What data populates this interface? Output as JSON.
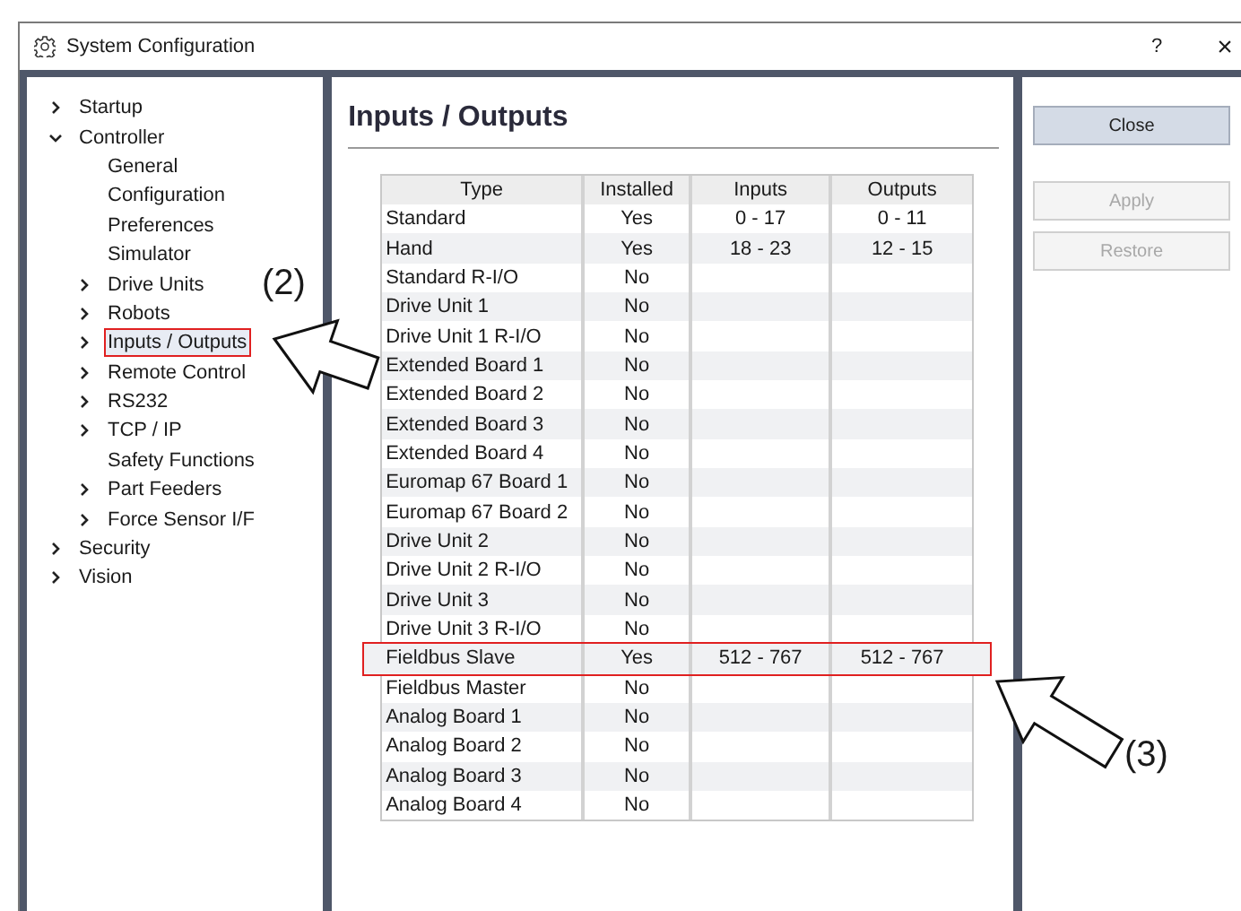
{
  "window": {
    "title": "System Configuration",
    "help": "?",
    "close": "×"
  },
  "tree": [
    {
      "label": "Startup",
      "kind": "node",
      "expanded": false,
      "selected": false
    },
    {
      "label": "Controller",
      "kind": "node",
      "expanded": true,
      "selected": false,
      "children": [
        {
          "label": "General",
          "kind": "leaf",
          "selected": false
        },
        {
          "label": "Configuration",
          "kind": "leaf",
          "selected": false
        },
        {
          "label": "Preferences",
          "kind": "leaf",
          "selected": false
        },
        {
          "label": "Simulator",
          "kind": "leaf",
          "selected": false
        },
        {
          "label": "Drive Units",
          "kind": "node",
          "expanded": false,
          "selected": false
        },
        {
          "label": "Robots",
          "kind": "node",
          "expanded": false,
          "selected": false
        },
        {
          "label": "Inputs / Outputs",
          "kind": "node",
          "expanded": false,
          "selected": true,
          "annotated": true
        },
        {
          "label": "Remote Control",
          "kind": "node",
          "expanded": false,
          "selected": false
        },
        {
          "label": "RS232",
          "kind": "node",
          "expanded": false,
          "selected": false
        },
        {
          "label": "TCP / IP",
          "kind": "node",
          "expanded": false,
          "selected": false
        },
        {
          "label": "Safety Functions",
          "kind": "leaf",
          "selected": false
        },
        {
          "label": "Part Feeders",
          "kind": "node",
          "expanded": false,
          "selected": false
        },
        {
          "label": "Force Sensor I/F",
          "kind": "node",
          "expanded": false,
          "selected": false
        }
      ]
    },
    {
      "label": "Security",
      "kind": "node",
      "expanded": false,
      "selected": false
    },
    {
      "label": "Vision",
      "kind": "node",
      "expanded": false,
      "selected": false
    }
  ],
  "page_title": "Inputs / Outputs",
  "table": {
    "columns": [
      "Type",
      "Installed",
      "Inputs",
      "Outputs"
    ],
    "rows": [
      {
        "type": "Standard",
        "installed": "Yes",
        "inputs": "0 - 17",
        "outputs": "0 - 11"
      },
      {
        "type": "Hand",
        "installed": "Yes",
        "inputs": "18 - 23",
        "outputs": "12 - 15"
      },
      {
        "type": "Standard R-I/O",
        "installed": "No"
      },
      {
        "type": "Drive Unit 1",
        "installed": "No"
      },
      {
        "type": "Drive Unit 1 R-I/O",
        "installed": "No"
      },
      {
        "type": "Extended Board 1",
        "installed": "No"
      },
      {
        "type": "Extended Board 2",
        "installed": "No"
      },
      {
        "type": "Extended Board 3",
        "installed": "No"
      },
      {
        "type": "Extended Board 4",
        "installed": "No"
      },
      {
        "type": "Euromap 67 Board 1",
        "installed": "No"
      },
      {
        "type": "Euromap 67 Board 2",
        "installed": "No"
      },
      {
        "type": "Drive Unit 2",
        "installed": "No"
      },
      {
        "type": "Drive Unit 2 R-I/O",
        "installed": "No"
      },
      {
        "type": "Drive Unit 3",
        "installed": "No"
      },
      {
        "type": "Drive Unit 3 R-I/O",
        "installed": "No"
      },
      {
        "type": "Fieldbus Slave",
        "installed": "Yes",
        "inputs": "512 - 767",
        "outputs": "512 - 767",
        "annotated": true
      },
      {
        "type": "Fieldbus Master",
        "installed": "No"
      },
      {
        "type": "Analog Board 1",
        "installed": "No"
      },
      {
        "type": "Analog Board 2",
        "installed": "No"
      },
      {
        "type": "Analog Board 3",
        "installed": "No"
      },
      {
        "type": "Analog Board 4",
        "installed": "No"
      }
    ]
  },
  "buttons": [
    {
      "label": "Close",
      "disabled": false
    },
    {
      "label": "Apply",
      "disabled": true
    },
    {
      "label": "Restore",
      "disabled": true
    }
  ],
  "callouts": [
    {
      "label": "(2)"
    },
    {
      "label": "(3)"
    }
  ]
}
